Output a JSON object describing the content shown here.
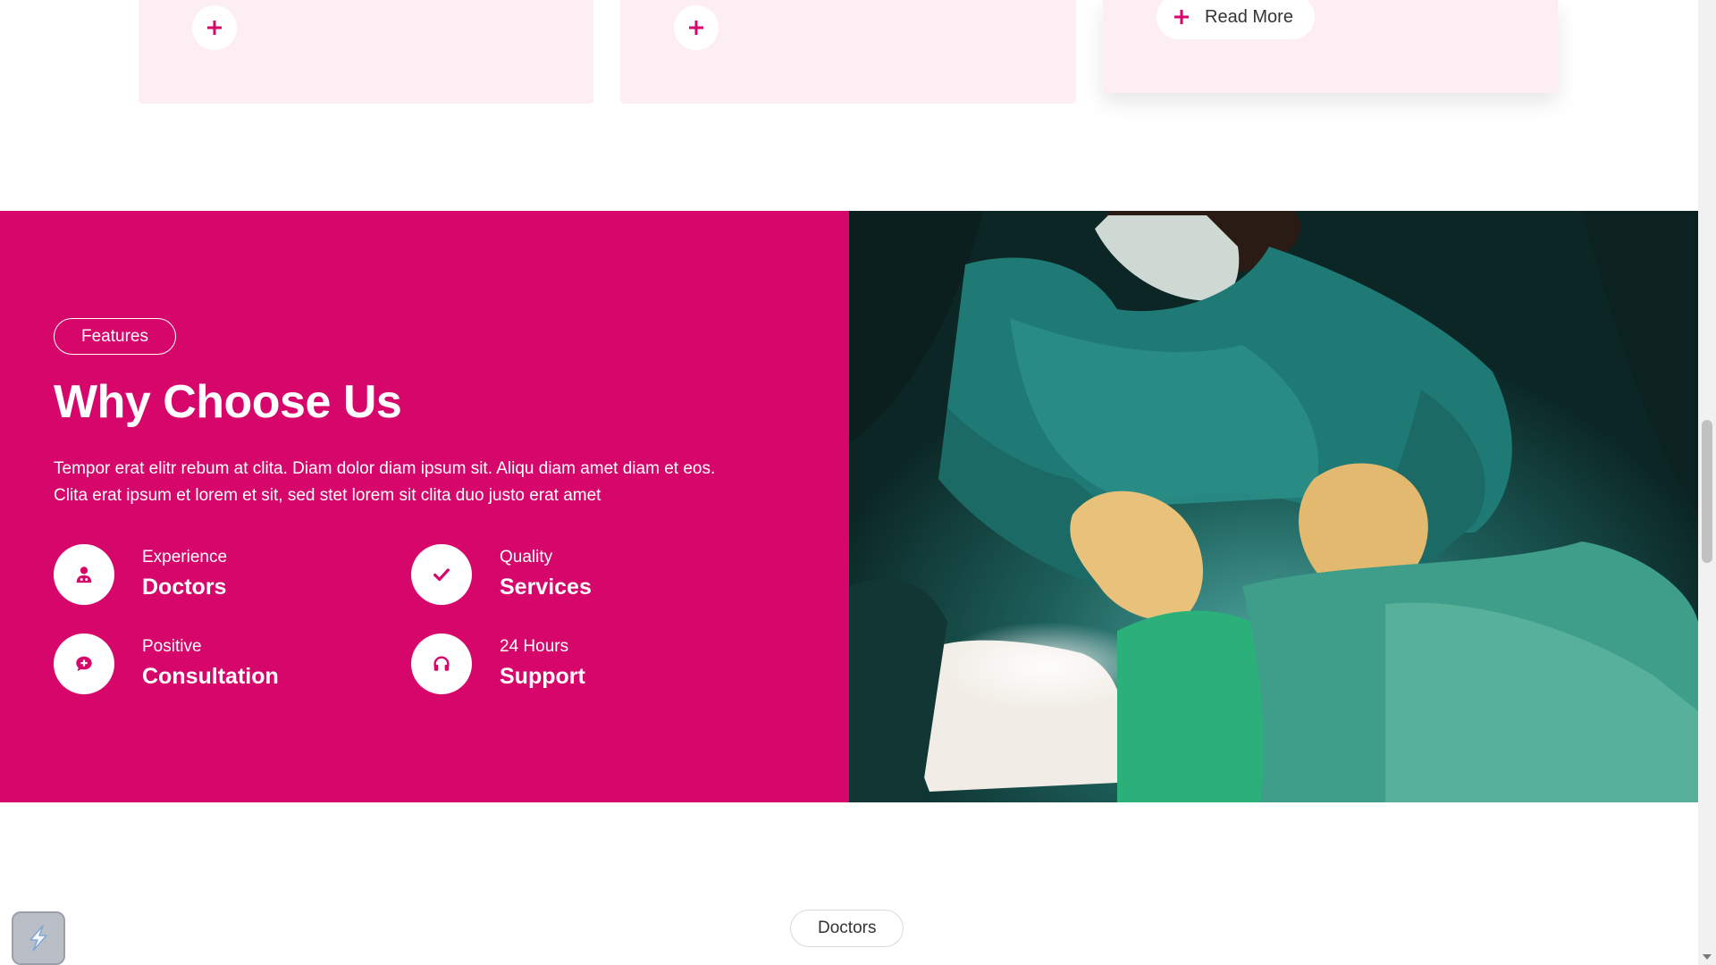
{
  "services": {
    "cards": [
      {
        "button": "plus"
      },
      {
        "button": "plus"
      },
      {
        "button_label": "Read More"
      }
    ]
  },
  "features": {
    "badge": "Features",
    "title": "Why Choose Us",
    "description": "Tempor erat elitr rebum at clita. Diam dolor diam ipsum sit. Aliqu diam amet diam et eos. Clita erat ipsum et lorem et sit, sed stet lorem sit clita duo justo erat amet",
    "items": [
      {
        "icon": "user-doctor-icon",
        "small": "Experience",
        "big": "Doctors"
      },
      {
        "icon": "check-icon",
        "small": "Quality",
        "big": "Services"
      },
      {
        "icon": "comment-medical-icon",
        "small": "Positive",
        "big": "Consultation"
      },
      {
        "icon": "headphones-icon",
        "small": "24 Hours",
        "big": "Support"
      }
    ],
    "image_subject": "surgeon-operating-photo"
  },
  "next_section": {
    "badge": "Doctors"
  },
  "colors": {
    "primary": "#d6066b",
    "card_bg": "#fdeef3"
  }
}
